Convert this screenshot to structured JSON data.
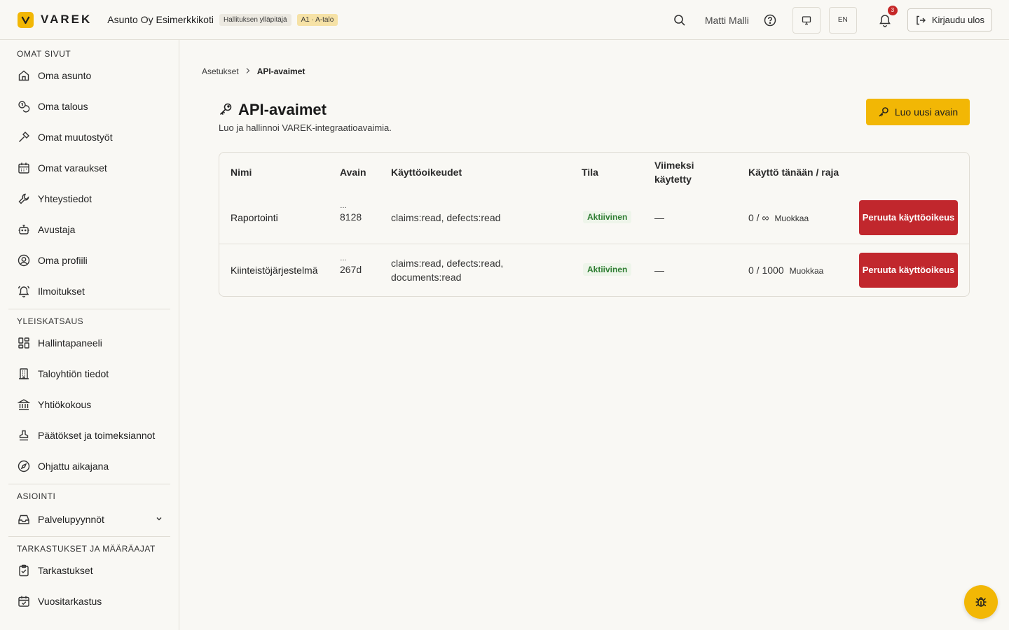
{
  "header": {
    "logo_text": "VAREK",
    "org_name": "Asunto Oy Esimerkkikoti",
    "role_badge": "Hallituksen ylläpitäjä",
    "unit_badge": "A1 · A-talo",
    "user_name": "Matti Malli",
    "language": "EN",
    "notification_count": "3",
    "logout_label": "Kirjaudu ulos"
  },
  "sidebar": {
    "sections": [
      {
        "title": "OMAT SIVUT",
        "items": [
          {
            "label": "Oma asunto",
            "icon": "home-icon"
          },
          {
            "label": "Oma talous",
            "icon": "coins-icon"
          },
          {
            "label": "Omat muutostyöt",
            "icon": "hammer-icon"
          },
          {
            "label": "Omat varaukset",
            "icon": "calendar-icon"
          },
          {
            "label": "Yhteystiedot",
            "icon": "wrench-icon"
          },
          {
            "label": "Avustaja",
            "icon": "bot-icon"
          },
          {
            "label": "Oma profiili",
            "icon": "user-circle-icon"
          },
          {
            "label": "Ilmoitukset",
            "icon": "bell-ring-icon"
          }
        ]
      },
      {
        "title": "YLEISKATSAUS",
        "items": [
          {
            "label": "Hallintapaneeli",
            "icon": "dashboard-icon"
          },
          {
            "label": "Taloyhtiön tiedot",
            "icon": "building-icon"
          },
          {
            "label": "Yhtiökokous",
            "icon": "landmark-icon"
          },
          {
            "label": "Päätökset ja toimeksiannot",
            "icon": "stamp-icon"
          },
          {
            "label": "Ohjattu aikajana",
            "icon": "compass-icon"
          }
        ]
      },
      {
        "title": "ASIOINTI",
        "items": [
          {
            "label": "Palvelupyynnöt",
            "icon": "inbox-icon"
          }
        ]
      },
      {
        "title": "TARKASTUKSET JA MÄÄRÄAJAT",
        "items": [
          {
            "label": "Tarkastukset",
            "icon": "clipboard-check-icon"
          },
          {
            "label": "Vuositarkastus",
            "icon": "calendar-check-icon"
          }
        ]
      }
    ]
  },
  "breadcrumb": {
    "parent": "Asetukset",
    "current": "API-avaimet"
  },
  "page": {
    "title": "API-avaimet",
    "subtitle": "Luo ja hallinnoi VAREK-integraatioavaimia.",
    "new_key_label": "Luo uusi avain"
  },
  "table": {
    "headers": {
      "name": "Nimi",
      "key": "Avain",
      "scopes": "Käyttöoikeudet",
      "status": "Tila",
      "last_used": "Viimeksi käytetty",
      "usage": "Käyttö tänään / raja"
    },
    "rows": [
      {
        "name": "Raportointi",
        "key_dots": "…",
        "key_suffix": "8128",
        "scopes": "claims:read, defects:read",
        "status": "Aktiivinen",
        "last_used": "—",
        "usage": "0 / ∞",
        "edit": "Muokkaa",
        "revoke": "Peruuta käyttöoikeus"
      },
      {
        "name": "Kiinteistöjärjestelmä",
        "key_dots": "…",
        "key_suffix": "267d",
        "scopes": "claims:read, defects:read, documents:read",
        "status": "Aktiivinen",
        "last_used": "—",
        "usage": "0 / 1000",
        "edit": "Muokkaa",
        "revoke": "Peruuta käyttöoikeus"
      }
    ]
  },
  "colors": {
    "accent": "#f2b705",
    "danger": "#c1272d",
    "success": "#2e7d32",
    "background": "#f9f8f4"
  }
}
